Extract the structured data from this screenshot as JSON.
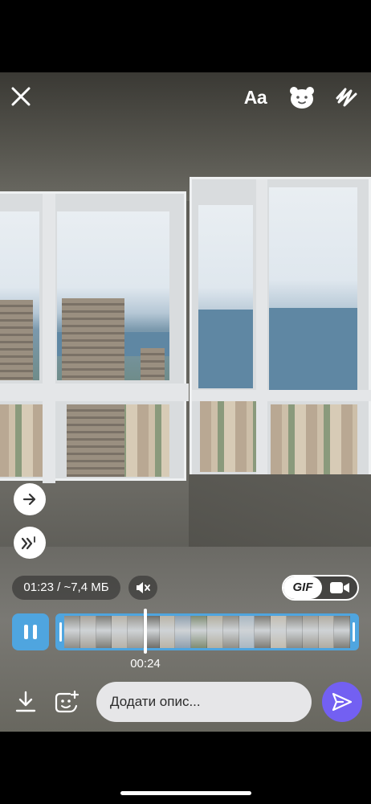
{
  "toolbar": {
    "close_icon": "close-icon",
    "text_label": "Aa",
    "sticker_icon": "bear-face-icon",
    "draw_icon": "draw-scribble-icon"
  },
  "side_buttons": {
    "forward_icon": "arrow-right-icon",
    "speed_icon": "double-chevron-speed-icon"
  },
  "video_info": {
    "duration_size": "01:23 / ~7,4 МБ",
    "mute_icon": "speaker-muted-icon"
  },
  "format_toggle": {
    "gif_label": "GIF",
    "video_icon": "video-camera-icon",
    "selected": "GIF"
  },
  "timeline": {
    "pause_icon": "pause-icon",
    "playhead_time": "00:24",
    "thumbnail_colors": [
      "#8d8c86",
      "#a8a39a",
      "#7d7c76",
      "#b7b2a8",
      "#9a9891",
      "#6f6e69",
      "#b9b3a6",
      "#8f9fae",
      "#7f8c72",
      "#b3ae9e",
      "#908e86",
      "#a9b7c2",
      "#7d7b74",
      "#c2bcaf",
      "#8b8a84",
      "#9d9990",
      "#b1aca1",
      "#7e7d77"
    ]
  },
  "bottom_bar": {
    "download_icon": "download-icon",
    "add_sticker_icon": "add-sticker-icon",
    "caption_placeholder": "Додати опис...",
    "caption_value": "",
    "send_icon": "send-icon"
  },
  "colors": {
    "accent_blue": "#4fa5df",
    "send_purple": "#7360f2",
    "input_background": "#e6e6e8"
  }
}
